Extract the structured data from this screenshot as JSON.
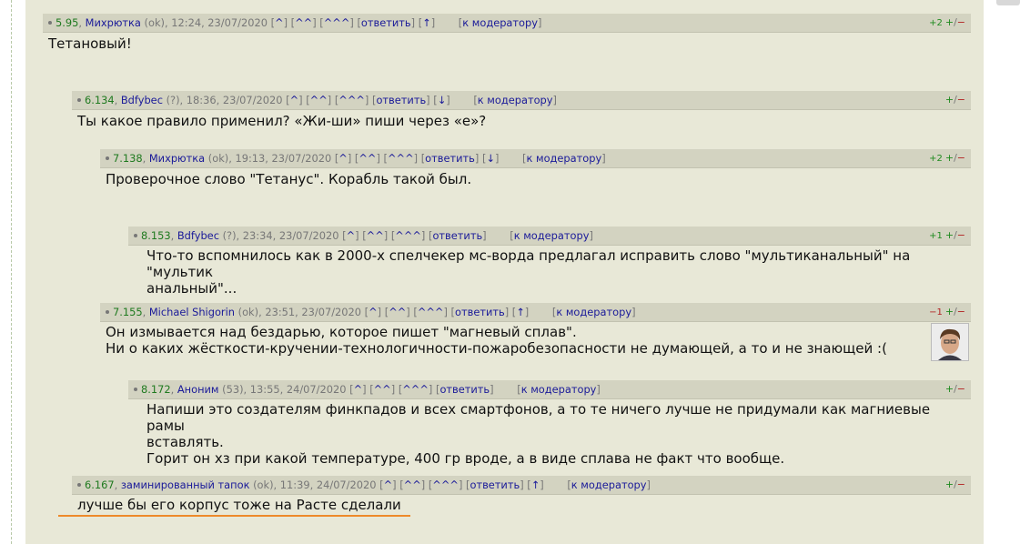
{
  "link_labels": {
    "up1": "^",
    "up2": "^^",
    "up3": "^^^",
    "reply": "ответить",
    "moderator": "к модератору",
    "vote": "+/−"
  },
  "colors": {
    "panel": "#e8e8d7",
    "header": "#d3d3c1",
    "score": "#1f7a1f",
    "link": "#1a1a99",
    "underline": "#ee8a2a"
  },
  "comments": [
    {
      "id": "c1",
      "score": "5.95",
      "author": "Михрютка",
      "meta": "(ok), 12:24, 23/07/2020",
      "nav_arrow": "↑",
      "vote_count": "+2",
      "body": [
        "Тетановый!"
      ]
    },
    {
      "id": "c2",
      "score": "6.134",
      "author": "Bdfybec",
      "meta": "(?), 18:36, 23/07/2020",
      "nav_arrow": "↓",
      "vote_count": "",
      "body": [
        "Ты какое правило применил? «Жи-ши» пиши через «е»?"
      ]
    },
    {
      "id": "c3",
      "score": "7.138",
      "author": "Михрютка",
      "meta": "(ok), 19:13, 23/07/2020",
      "nav_arrow": "↓",
      "vote_count": "+2",
      "body": [
        "Проверочное слово \"Тетанус\". Корабль такой был."
      ]
    },
    {
      "id": "c4",
      "score": "8.153",
      "author": "Bdfybec",
      "meta": "(?), 23:34, 23/07/2020",
      "nav_arrow": "",
      "vote_count": "+1",
      "body": [
        "Что-то вспомнилось как в 2000-х спелчекер мс-ворда предлагал исправить слово \"мультиканальный\" на \"мультик",
        "анальный\"..."
      ]
    },
    {
      "id": "c5",
      "score": "7.155",
      "author": "Michael Shigorin",
      "meta": "(ok), 23:51, 23/07/2020",
      "nav_arrow": "↑",
      "vote_count": "−1",
      "body": [
        "Он измывается над бездарью, которое пишет \"магневый сплав\".",
        "Ни о каких жёсткости-кручении-технологичности-пожаробезопасности не думающей, а то и не знающей :("
      ]
    },
    {
      "id": "c6",
      "score": "8.172",
      "author": "Аноним",
      "meta": "(53), 13:55, 24/07/2020",
      "nav_arrow": "",
      "vote_count": "",
      "body": [
        "Напиши это создателям финкпадов и всех смартфонов, а то те ничего лучше не придумали как магниевые рамы",
        "вставлять.",
        "Горит он хз при какой температуре, 400 гр вроде, а в виде сплава не факт что вообще."
      ]
    },
    {
      "id": "c7",
      "score": "6.167",
      "author": "заминированный тапок",
      "meta": "(ok), 11:39, 24/07/2020",
      "nav_arrow": "↑",
      "vote_count": "",
      "body": [
        "лучше бы его корпус тоже на Расте сделали"
      ]
    }
  ]
}
